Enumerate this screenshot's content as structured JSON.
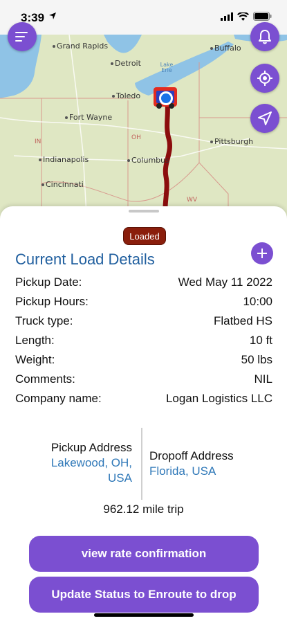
{
  "status_bar": {
    "time": "3:39"
  },
  "map": {
    "cities": [
      {
        "name": "Grand Rapids",
        "key": "grand-rapids"
      },
      {
        "name": "Detroit",
        "key": "detroit"
      },
      {
        "name": "Buffalo",
        "key": "buffalo"
      },
      {
        "name": "Toledo",
        "key": "toledo"
      },
      {
        "name": "Fort Wayne",
        "key": "fort-wayne"
      },
      {
        "name": "Pittsburgh",
        "key": "pittsburgh"
      },
      {
        "name": "Indianapolis",
        "key": "indianapolis"
      },
      {
        "name": "Columbus",
        "key": "columbus"
      },
      {
        "name": "Cincinnati",
        "key": "cincinnati"
      }
    ],
    "states": {
      "in": "IN",
      "oh": "OH",
      "wv": "WV"
    },
    "lake_label": "Lake Erie"
  },
  "load": {
    "status_badge": "Loaded",
    "title": "Current Load Details",
    "details": [
      {
        "label": "Pickup Date:",
        "value": "Wed May 11 2022"
      },
      {
        "label": "Pickup Hours:",
        "value": "10:00"
      },
      {
        "label": "Truck type:",
        "value": "Flatbed HS"
      },
      {
        "label": "Length:",
        "value": "10 ft"
      },
      {
        "label": "Weight:",
        "value": "50 lbs"
      },
      {
        "label": "Comments:",
        "value": "NIL"
      },
      {
        "label": "Company name:",
        "value": "Logan Logistics LLC"
      }
    ],
    "pickup": {
      "heading": "Pickup Address",
      "line1": "Lakewood, OH,",
      "line2": "USA"
    },
    "dropoff": {
      "heading": "Dropoff Address",
      "line1": "Florida, USA"
    },
    "trip": "962.12 mile trip"
  },
  "actions": {
    "rate_confirmation": "view rate confirmation",
    "update_status": "Update Status to Enroute to drop"
  },
  "colors": {
    "accent": "#7b4fd1",
    "badge": "#8a1e0c",
    "title": "#1f5e9e",
    "link": "#2f78b8",
    "route": "#8b0d0d"
  }
}
